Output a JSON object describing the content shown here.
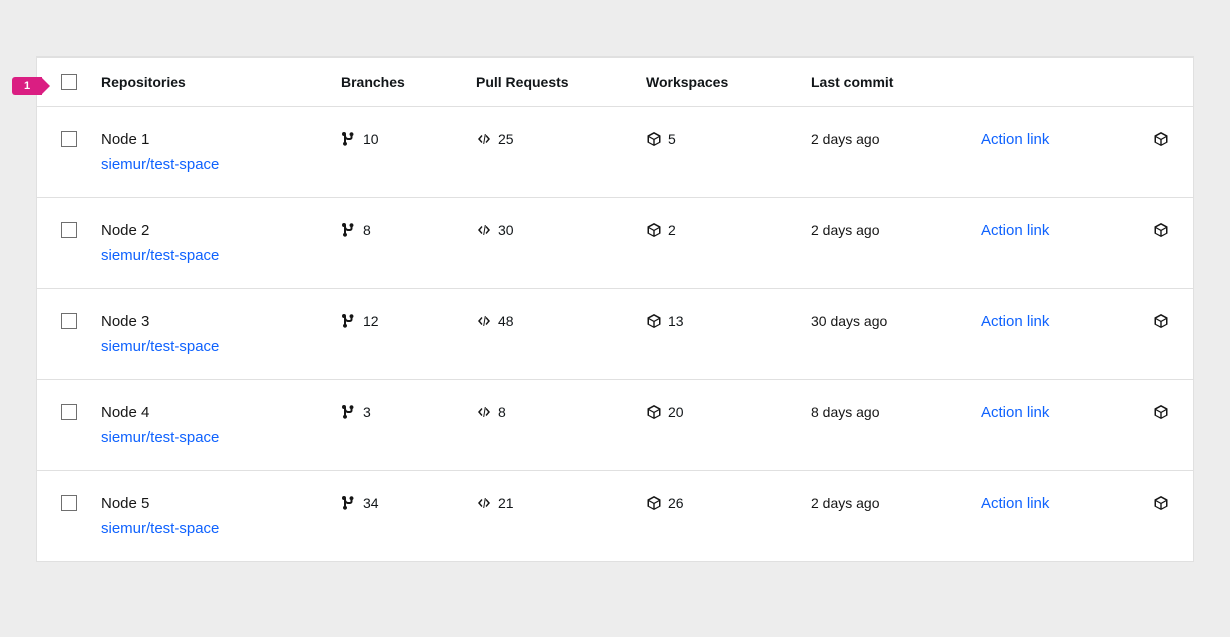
{
  "annotation": {
    "badge": "1"
  },
  "headers": {
    "repositories": "Repositories",
    "branches": "Branches",
    "pull_requests": "Pull Requests",
    "workspaces": "Workspaces",
    "last_commit": "Last commit"
  },
  "action_label": "Action link",
  "rows": [
    {
      "name": "Node 1",
      "path": "siemur/test-space",
      "branches": "10",
      "pull_requests": "25",
      "workspaces": "5",
      "last_commit": "2 days ago"
    },
    {
      "name": "Node 2",
      "path": "siemur/test-space",
      "branches": "8",
      "pull_requests": "30",
      "workspaces": "2",
      "last_commit": "2 days ago"
    },
    {
      "name": "Node 3",
      "path": "siemur/test-space",
      "branches": "12",
      "pull_requests": "48",
      "workspaces": "13",
      "last_commit": "30 days ago"
    },
    {
      "name": "Node 4",
      "path": "siemur/test-space",
      "branches": "3",
      "pull_requests": "8",
      "workspaces": "20",
      "last_commit": "8 days ago"
    },
    {
      "name": "Node 5",
      "path": "siemur/test-space",
      "branches": "34",
      "pull_requests": "21",
      "workspaces": "26",
      "last_commit": "2 days ago"
    }
  ]
}
